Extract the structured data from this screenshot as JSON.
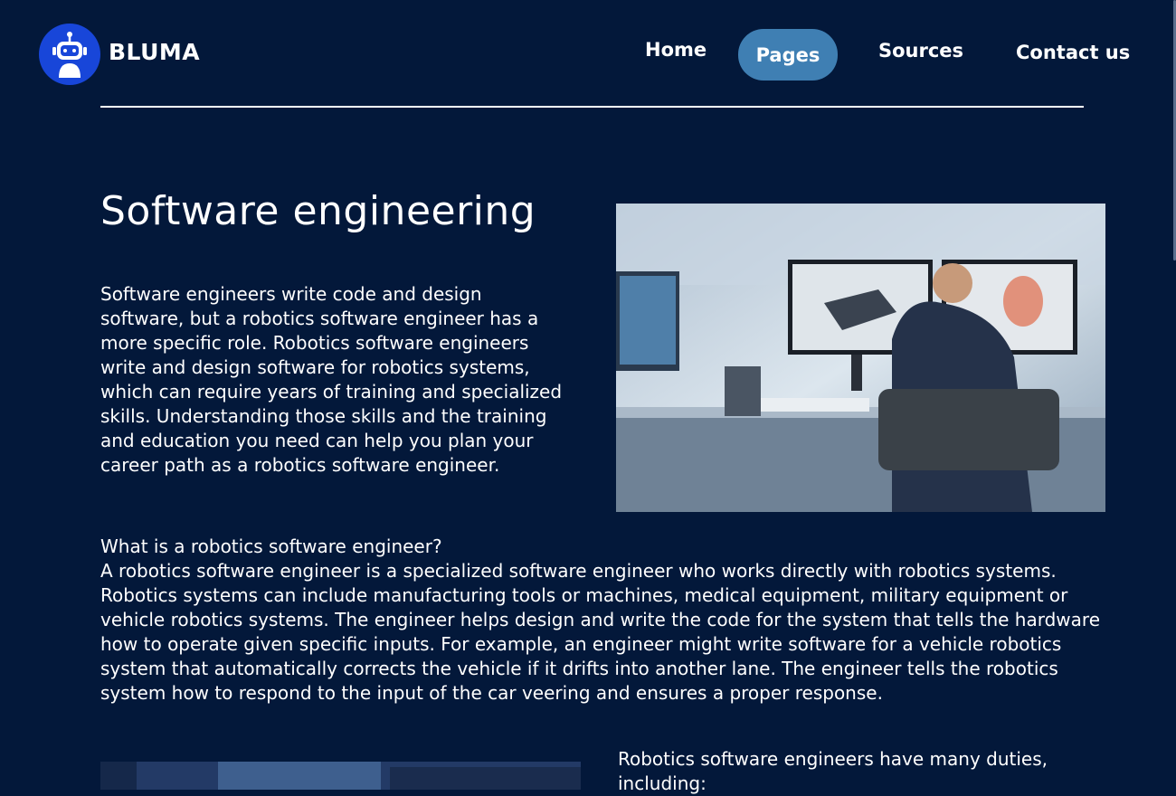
{
  "header": {
    "brand": "BLUMA",
    "logo_icon": "robot-icon",
    "nav": [
      {
        "label": "Home",
        "active": false
      },
      {
        "label": "Pages",
        "active": true
      },
      {
        "label": "Sources",
        "active": false
      },
      {
        "label": "Contact us",
        "active": false
      }
    ]
  },
  "main": {
    "title": "Software engineering",
    "intro": "Software engineers write code and design software, but a robotics software engineer has a more specific role. Robotics software engineers write and design software for robotics systems, which can require years of training and specialized skills. Understanding those skills and the training and education you need can help you plan your career path as a robotics software engineer.",
    "subheading": "What is a robotics software engineer?",
    "paragraph": "A robotics software engineer is a specialized software engineer who works directly with robotics systems. Robotics systems can include manufacturing tools or machines, medical equipment, military equipment or vehicle robotics systems. The engineer helps design and write the code for the system that tells the hardware how to operate given specific inputs. For example, an engineer might write software for a vehicle robotics system that automatically corrects the vehicle if it drifts into another lane. The engineer tells the robotics system how to respond to the input of the car veering and ensures a proper response.",
    "duties_intro": "Robotics software engineers have many duties, including:"
  },
  "colors": {
    "background": "#03183a",
    "logo_circle": "#1846d9",
    "nav_active": "#3f7fb3",
    "text": "#ffffff"
  }
}
